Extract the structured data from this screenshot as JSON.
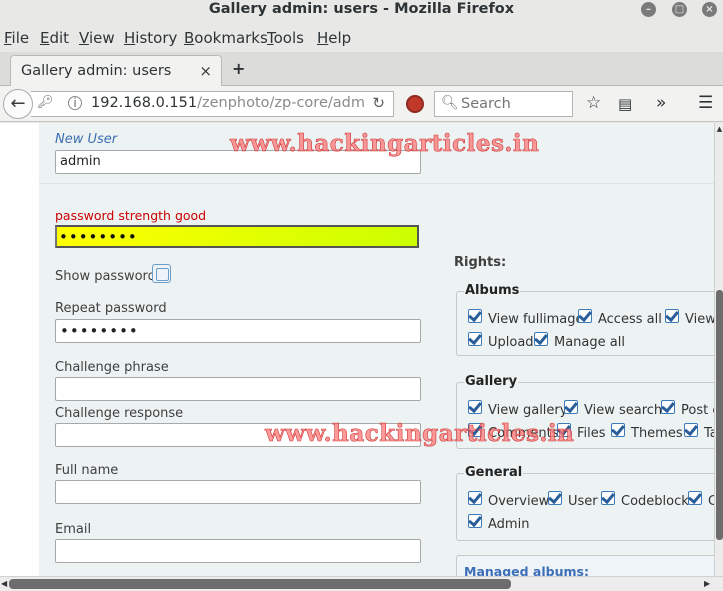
{
  "window": {
    "title": "Gallery admin: users - Mozilla Firefox"
  },
  "menu": [
    "File",
    "Edit",
    "View",
    "History",
    "Bookmarks",
    "Tools",
    "Help"
  ],
  "menu_accel": [
    "F",
    "E",
    "V",
    "H",
    "B",
    "T",
    "H"
  ],
  "tab": {
    "label": "Gallery admin: users",
    "close": "×",
    "new_tab": "+"
  },
  "nav": {
    "url_host": "192.168.0.151",
    "url_path": "/zenphoto/zp-core/adm",
    "search_placeholder": "Search"
  },
  "form": {
    "new_user_label": "New User",
    "username_value": "admin",
    "strength_text": "password strength good",
    "password_mask": "••••••••",
    "show_password_label": "Show password",
    "repeat_password_label": "Repeat password",
    "repeat_password_mask": "••••••••",
    "challenge_phrase_label": "Challenge phrase",
    "challenge_phrase_value": "",
    "challenge_response_label": "Challenge response",
    "challenge_response_value": "",
    "full_name_label": "Full name",
    "full_name_value": "",
    "email_label": "Email",
    "email_value": ""
  },
  "rights": {
    "title": "Rights:",
    "albums": {
      "legend": "Albums",
      "items": [
        "View fullimage",
        "Access all",
        "View",
        "Upload",
        "Manage all"
      ]
    },
    "gallery": {
      "legend": "Gallery",
      "items": [
        "View gallery",
        "View search",
        "Post c",
        "Comments",
        "Files",
        "Themes",
        "Ta"
      ]
    },
    "general": {
      "legend": "General",
      "items": [
        "Overview",
        "User",
        "Codeblock",
        "C",
        "Admin"
      ]
    },
    "managed_albums": "Managed albums:"
  },
  "watermark": "www.hackingarticles.in",
  "colors": {
    "strength_text": "#cc0000",
    "new_user": "#3a6fb0",
    "password_fill_start": "#ffff00",
    "password_fill_end": "#ccff00"
  }
}
